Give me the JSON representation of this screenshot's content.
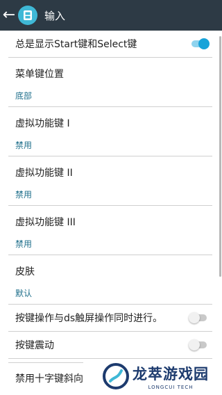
{
  "header": {
    "title": "输入",
    "back_icon": "arrow-left-icon",
    "app_icon": "gamepad-logo-icon",
    "background": "#2d3a45",
    "logo_color": "#3fb8d6"
  },
  "settings": {
    "always_show_start_select": {
      "label": "总是显示Start键和Select键",
      "enabled": true
    },
    "menu_key_position": {
      "label": "菜单键位置",
      "value": "底部"
    },
    "virtual_key_1": {
      "label": "虚拟功能键 I",
      "value": "禁用"
    },
    "virtual_key_2": {
      "label": "虚拟功能键 II",
      "value": "禁用"
    },
    "virtual_key_3": {
      "label": "虚拟功能键 III",
      "value": "禁用"
    },
    "skin": {
      "label": "皮肤",
      "value": "默认"
    },
    "simultaneous_touch": {
      "label": "按键操作与ds触屏操作同时进行。",
      "enabled": false
    },
    "key_vibration": {
      "label": "按键震动",
      "enabled": false
    },
    "disable_dpad_diagonal": {
      "label": "禁用十字键斜向"
    }
  },
  "colors": {
    "accent": "#17a3d9",
    "value_text": "#1f6f8b"
  },
  "watermark": {
    "cn": "龙萃游戏园",
    "en": "LONGCUI TECH"
  }
}
